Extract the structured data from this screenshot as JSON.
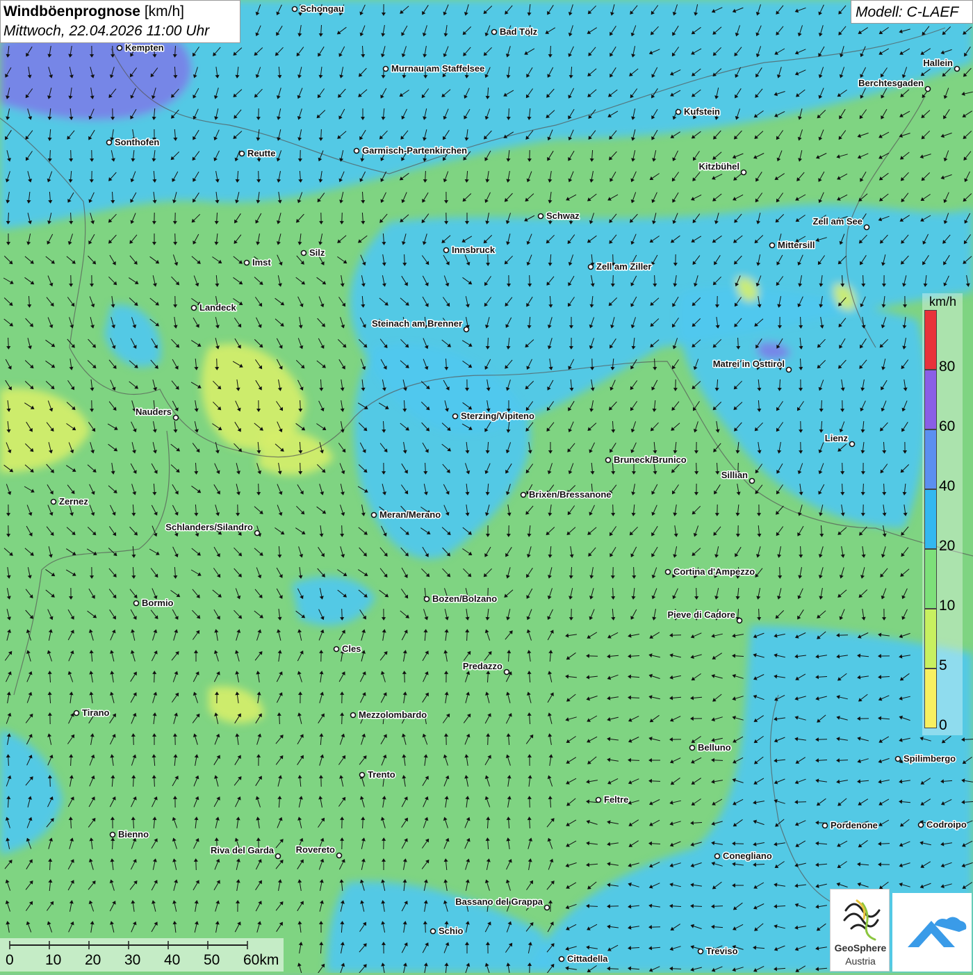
{
  "header": {
    "title_bold": "Windböenprognose",
    "title_unit": "[km/h]",
    "datetime": "Mittwoch, 22.04.2026 11:00 Uhr",
    "model": "Modell: C-LAEF"
  },
  "legend": {
    "unit": "km/h",
    "labels": [
      "80",
      "60",
      "40",
      "20",
      "10",
      "5",
      "0"
    ],
    "colors": [
      "#e8323a",
      "#8a5ee6",
      "#5b8ff0",
      "#33b8f0",
      "#7de07a",
      "#c8f060",
      "#f8f060"
    ]
  },
  "scale_bar": {
    "labels": [
      "0",
      "10",
      "20",
      "30",
      "40",
      "50",
      "60km"
    ]
  },
  "logo": {
    "name_line1": "GeoSphere",
    "name_line2": "Austria"
  },
  "cities": [
    {
      "name": "Schongau"
    },
    {
      "name": "Bad Tölz"
    },
    {
      "name": "Kempten"
    },
    {
      "name": "Murnau am Staffelsee"
    },
    {
      "name": "Hallein"
    },
    {
      "name": "Berchtesgaden"
    },
    {
      "name": "Kufstein"
    },
    {
      "name": "Sonthofen"
    },
    {
      "name": "Reutte"
    },
    {
      "name": "Garmisch-Partenkirchen"
    },
    {
      "name": "Kitzbühel"
    },
    {
      "name": "Schwaz"
    },
    {
      "name": "Zell am See"
    },
    {
      "name": "Mittersill"
    },
    {
      "name": "Innsbruck"
    },
    {
      "name": "Imst"
    },
    {
      "name": "Silz"
    },
    {
      "name": "Zell am Ziller"
    },
    {
      "name": "Landeck"
    },
    {
      "name": "Steinach am Brenner"
    },
    {
      "name": "Matrei in Osttirol"
    },
    {
      "name": "Nauders"
    },
    {
      "name": "Sterzing/Vipiteno"
    },
    {
      "name": "Lienz"
    },
    {
      "name": "Bruneck/Brunico"
    },
    {
      "name": "Sillian"
    },
    {
      "name": "Brixen/Bressanone"
    },
    {
      "name": "Zernez"
    },
    {
      "name": "Meran/Merano"
    },
    {
      "name": "Schlanders/Silandro"
    },
    {
      "name": "Cortina d'Ampezzo"
    },
    {
      "name": "Bormio"
    },
    {
      "name": "Bozen/Bolzano"
    },
    {
      "name": "Pieve di Cadore"
    },
    {
      "name": "Cles"
    },
    {
      "name": "Predazzo"
    },
    {
      "name": "Tirano"
    },
    {
      "name": "Mezzolombardo"
    },
    {
      "name": "Belluno"
    },
    {
      "name": "Spilimbergo"
    },
    {
      "name": "Trento"
    },
    {
      "name": "Feltre"
    },
    {
      "name": "Pordenone"
    },
    {
      "name": "Codroipo"
    },
    {
      "name": "Bienno"
    },
    {
      "name": "Riva del Garda"
    },
    {
      "name": "Rovereto"
    },
    {
      "name": "Conegliano"
    },
    {
      "name": "Bassano del Grappa"
    },
    {
      "name": "Schio"
    },
    {
      "name": "Treviso"
    },
    {
      "name": "Cittadella"
    }
  ]
}
